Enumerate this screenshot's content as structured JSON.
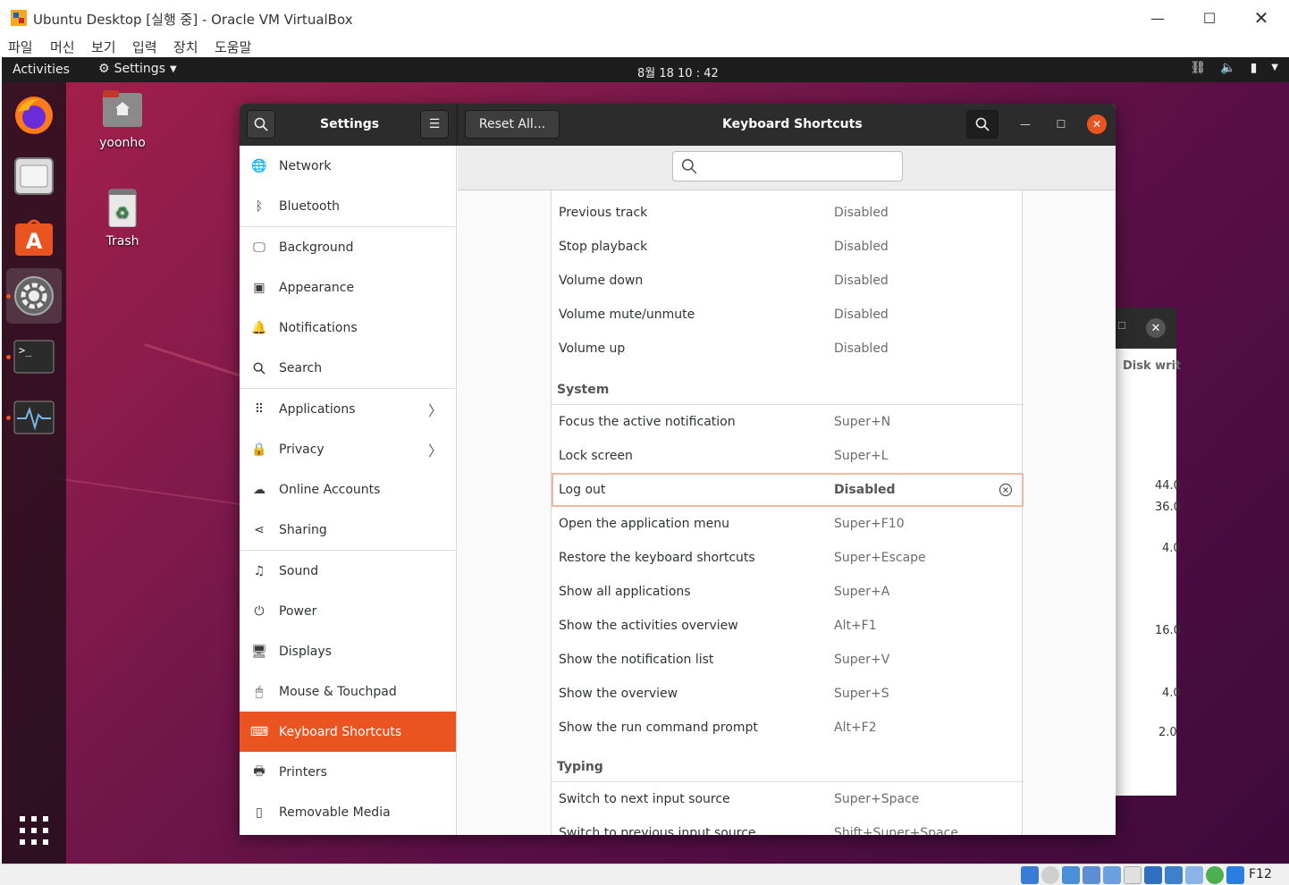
{
  "vbox": {
    "title": "Ubuntu Desktop [실행 중] - Oracle VM VirtualBox",
    "menu": [
      "파일",
      "머신",
      "보기",
      "입력",
      "장치",
      "도움말"
    ],
    "host_key": "F12"
  },
  "topbar": {
    "activities": "Activities",
    "app": "Settings",
    "clock": "8월 18  10 : 42"
  },
  "desktop": {
    "icons": [
      "yoonho",
      "Trash"
    ]
  },
  "bg_window": {
    "header": "Disk writ",
    "values": [
      "44.0",
      "36.0",
      "4.0",
      "16.0",
      "4.0",
      "2.0"
    ]
  },
  "headerbar": {
    "title_left": "Settings",
    "reset_label": "Reset All...",
    "title_right": "Keyboard Shortcuts"
  },
  "sidebar": {
    "items": [
      {
        "label": "Network",
        "icon": "network-icon"
      },
      {
        "label": "Bluetooth",
        "icon": "bluetooth-icon"
      },
      {
        "label": "Background",
        "icon": "background-icon"
      },
      {
        "label": "Appearance",
        "icon": "appearance-icon"
      },
      {
        "label": "Notifications",
        "icon": "bell-icon"
      },
      {
        "label": "Search",
        "icon": "search-icon"
      },
      {
        "label": "Applications",
        "icon": "grid-icon"
      },
      {
        "label": "Privacy",
        "icon": "lock-icon"
      },
      {
        "label": "Online Accounts",
        "icon": "cloud-icon"
      },
      {
        "label": "Sharing",
        "icon": "share-icon"
      },
      {
        "label": "Sound",
        "icon": "music-note-icon"
      },
      {
        "label": "Power",
        "icon": "power-icon"
      },
      {
        "label": "Displays",
        "icon": "display-icon"
      },
      {
        "label": "Mouse & Touchpad",
        "icon": "mouse-icon"
      },
      {
        "label": "Keyboard Shortcuts",
        "icon": "keyboard-icon"
      },
      {
        "label": "Printers",
        "icon": "printer-icon"
      },
      {
        "label": "Removable Media",
        "icon": "media-icon"
      }
    ],
    "selected": "Keyboard Shortcuts"
  },
  "search": {
    "placeholder": ""
  },
  "shortcuts": {
    "sound": [
      {
        "name": "Previous track",
        "accel": "Disabled"
      },
      {
        "name": "Stop playback",
        "accel": "Disabled"
      },
      {
        "name": "Volume down",
        "accel": "Disabled"
      },
      {
        "name": "Volume mute/unmute",
        "accel": "Disabled"
      },
      {
        "name": "Volume up",
        "accel": "Disabled"
      }
    ],
    "system_title": "System",
    "system": [
      {
        "name": "Focus the active notification",
        "accel": "Super+N"
      },
      {
        "name": "Lock screen",
        "accel": "Super+L"
      },
      {
        "name": "Log out",
        "accel": "Disabled"
      },
      {
        "name": "Open the application menu",
        "accel": "Super+F10"
      },
      {
        "name": "Restore the keyboard shortcuts",
        "accel": "Super+Escape"
      },
      {
        "name": "Show all applications",
        "accel": "Super+A"
      },
      {
        "name": "Show the activities overview",
        "accel": "Alt+F1"
      },
      {
        "name": "Show the notification list",
        "accel": "Super+V"
      },
      {
        "name": "Show the overview",
        "accel": "Super+S"
      },
      {
        "name": "Show the run command prompt",
        "accel": "Alt+F2"
      }
    ],
    "typing_title": "Typing",
    "typing": [
      {
        "name": "Switch to next input source",
        "accel": "Super+Space"
      },
      {
        "name": "Switch to previous input source",
        "accel": "Shift+Super+Space"
      }
    ]
  },
  "colors": {
    "accent": "#e95420",
    "headerbar": "#2c2c2c"
  }
}
